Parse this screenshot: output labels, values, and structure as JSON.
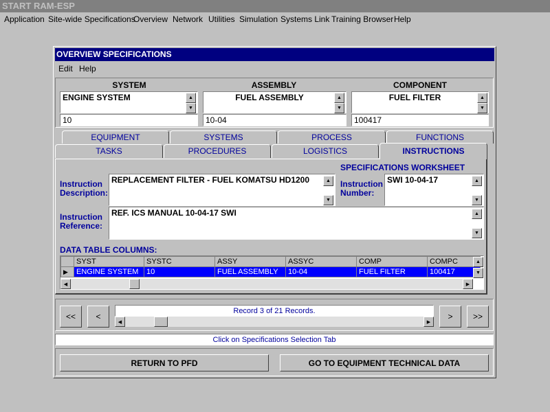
{
  "app_title": "START RAM-ESP",
  "menubar": [
    "Application",
    "Site-wide Specifications",
    "Overview",
    "Network",
    "Utilities",
    "Simulation",
    "Systems Link",
    "Training Browser",
    "Help"
  ],
  "window": {
    "title": "OVERVIEW SPECIFICATIONS",
    "menu": [
      "Edit",
      "Help"
    ]
  },
  "header": {
    "system": {
      "label": "SYSTEM",
      "name": "ENGINE SYSTEM",
      "code": "10"
    },
    "assembly": {
      "label": "ASSEMBLY",
      "name": "FUEL ASSEMBLY",
      "code": "10-04"
    },
    "component": {
      "label": "COMPONENT",
      "name": "FUEL FILTER",
      "code": "100417"
    }
  },
  "tabs_back": [
    "EQUIPMENT",
    "SYSTEMS",
    "PROCESS",
    "FUNCTIONS"
  ],
  "tabs_front": [
    "TASKS",
    "PROCEDURES",
    "LOGISTICS",
    "INSTRUCTIONS"
  ],
  "active_tab": "INSTRUCTIONS",
  "panel": {
    "worksheet_label": "SPECIFICATIONS WORKSHEET",
    "instr_desc_label_1": "Instruction",
    "instr_desc_label_2": "Description:",
    "instr_desc_value": "REPLACEMENT FILTER - FUEL KOMATSU HD1200",
    "instr_num_label_1": "Instruction",
    "instr_num_label_2": "Number:",
    "instr_num_value": "SWI 10-04-17",
    "instr_ref_label_1": "Instruction",
    "instr_ref_label_2": "Reference:",
    "instr_ref_value": "REF. ICS MANUAL 10-04-17 SWI",
    "data_table_label": "DATA TABLE COLUMNS:"
  },
  "table": {
    "columns": [
      "SYST",
      "SYSTC",
      "ASSY",
      "ASSYC",
      "COMP",
      "COMPC"
    ],
    "rows": [
      [
        "ENGINE SYSTEM",
        "10",
        "FUEL ASSEMBLY",
        "10-04",
        "FUEL FILTER",
        "100417"
      ]
    ]
  },
  "nav": {
    "first": "<<",
    "prev": "<",
    "next": ">",
    "last": ">>",
    "record_text": "Record 3 of 21 Records."
  },
  "status_text": "Click on Specifications Selection Tab",
  "buttons": {
    "return": "RETURN TO PFD",
    "equipment": "GO TO EQUIPMENT TECHNICAL DATA"
  }
}
